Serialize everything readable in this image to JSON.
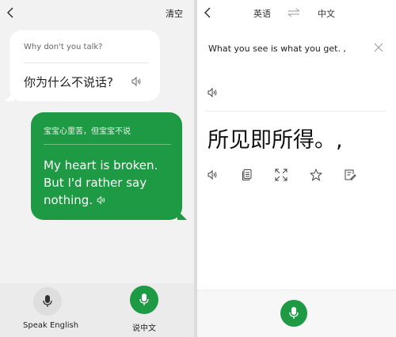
{
  "left": {
    "clear_label": "清空",
    "bubble1": {
      "source": "Why don't you talk?",
      "translation": "你为什么不说话?"
    },
    "bubble2": {
      "source": "宝宝心里苦，但宝宝不说",
      "translation": "My heart is broken. But I'd rather say nothing."
    },
    "bottom": {
      "speak_english_label": "Speak English",
      "speak_chinese_label": "说中文"
    }
  },
  "right": {
    "lang_from": "英语",
    "lang_to": "中文",
    "source_text": "What you see is what you get. ,",
    "translation": "所见即所得。,"
  },
  "colors": {
    "accent_green": "#1f9a44",
    "panel_bg": "#f2f2f2"
  },
  "icons": {
    "left": [
      "back-icon",
      "speaker-icon",
      "mic-icon"
    ],
    "right": [
      "back-icon",
      "swap-icon",
      "close-icon",
      "speaker-icon",
      "copy-icon",
      "expand-icon",
      "star-icon",
      "edit-icon",
      "mic-icon"
    ]
  }
}
